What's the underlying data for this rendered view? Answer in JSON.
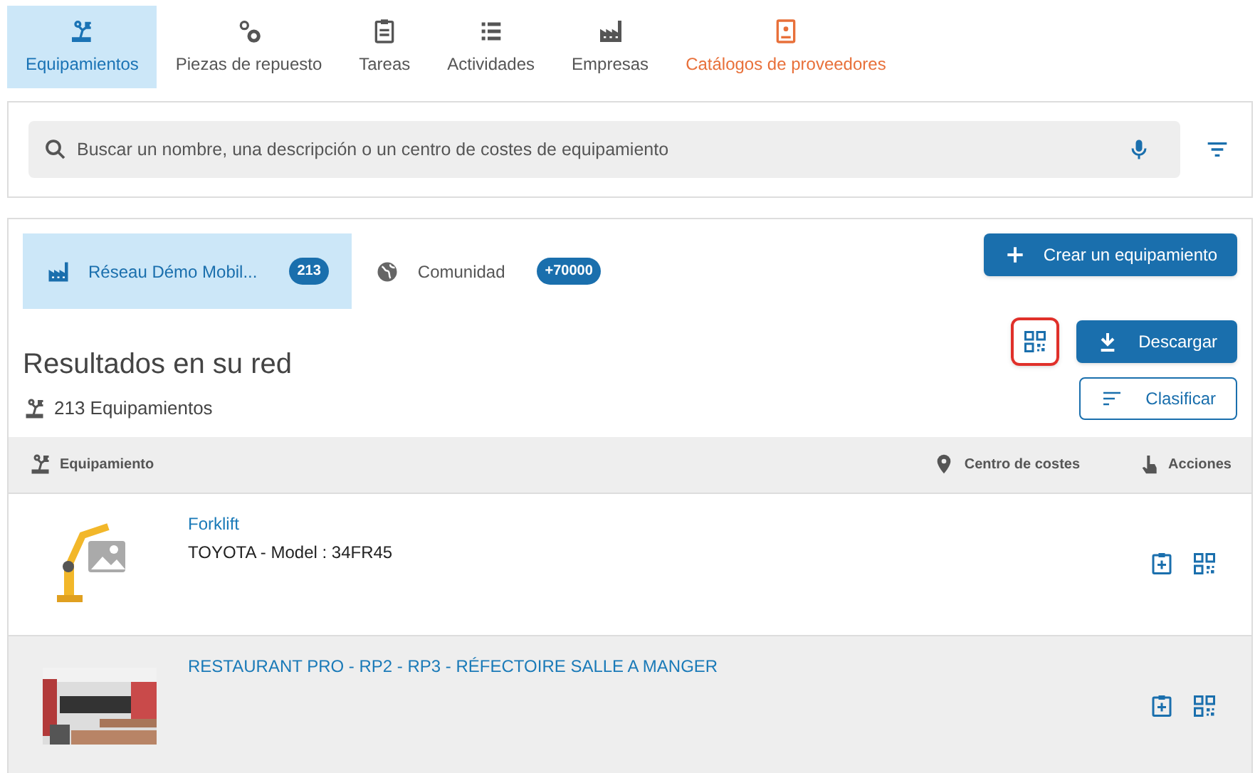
{
  "nav_tabs": [
    {
      "label": "Equipamientos",
      "selected": true
    },
    {
      "label": "Piezas de repuesto",
      "selected": false
    },
    {
      "label": "Tareas",
      "selected": false
    },
    {
      "label": "Actividades",
      "selected": false
    },
    {
      "label": "Empresas",
      "selected": false
    },
    {
      "label": "Catálogos de proveedores",
      "selected": false
    }
  ],
  "search": {
    "placeholder": "Buscar un nombre, una descripción o un centro de costes de equipamiento"
  },
  "scope_tabs": [
    {
      "label": "Réseau Démo Mobil...",
      "count": "213",
      "selected": true
    },
    {
      "label": "Comunidad",
      "count": "+70000",
      "selected": false
    }
  ],
  "create_button": "Crear un equipamiento",
  "download_button": "Descargar",
  "sort_button": "Clasificar",
  "results": {
    "title": "Resultados en su red",
    "count": "213 Equipamientos"
  },
  "table": {
    "columns": [
      "Equipamiento",
      "Centro de costes",
      "Acciones"
    ],
    "rows": [
      {
        "title": "Forklift",
        "subtitle": "TOYOTA - Model : 34FR45",
        "kind": "illustration",
        "selected": false
      },
      {
        "title": "RESTAURANT PRO - RP2 - RP3 - RÉFECTOIRE SALLE A MANGER",
        "kind": "picture",
        "selected": true
      }
    ]
  }
}
